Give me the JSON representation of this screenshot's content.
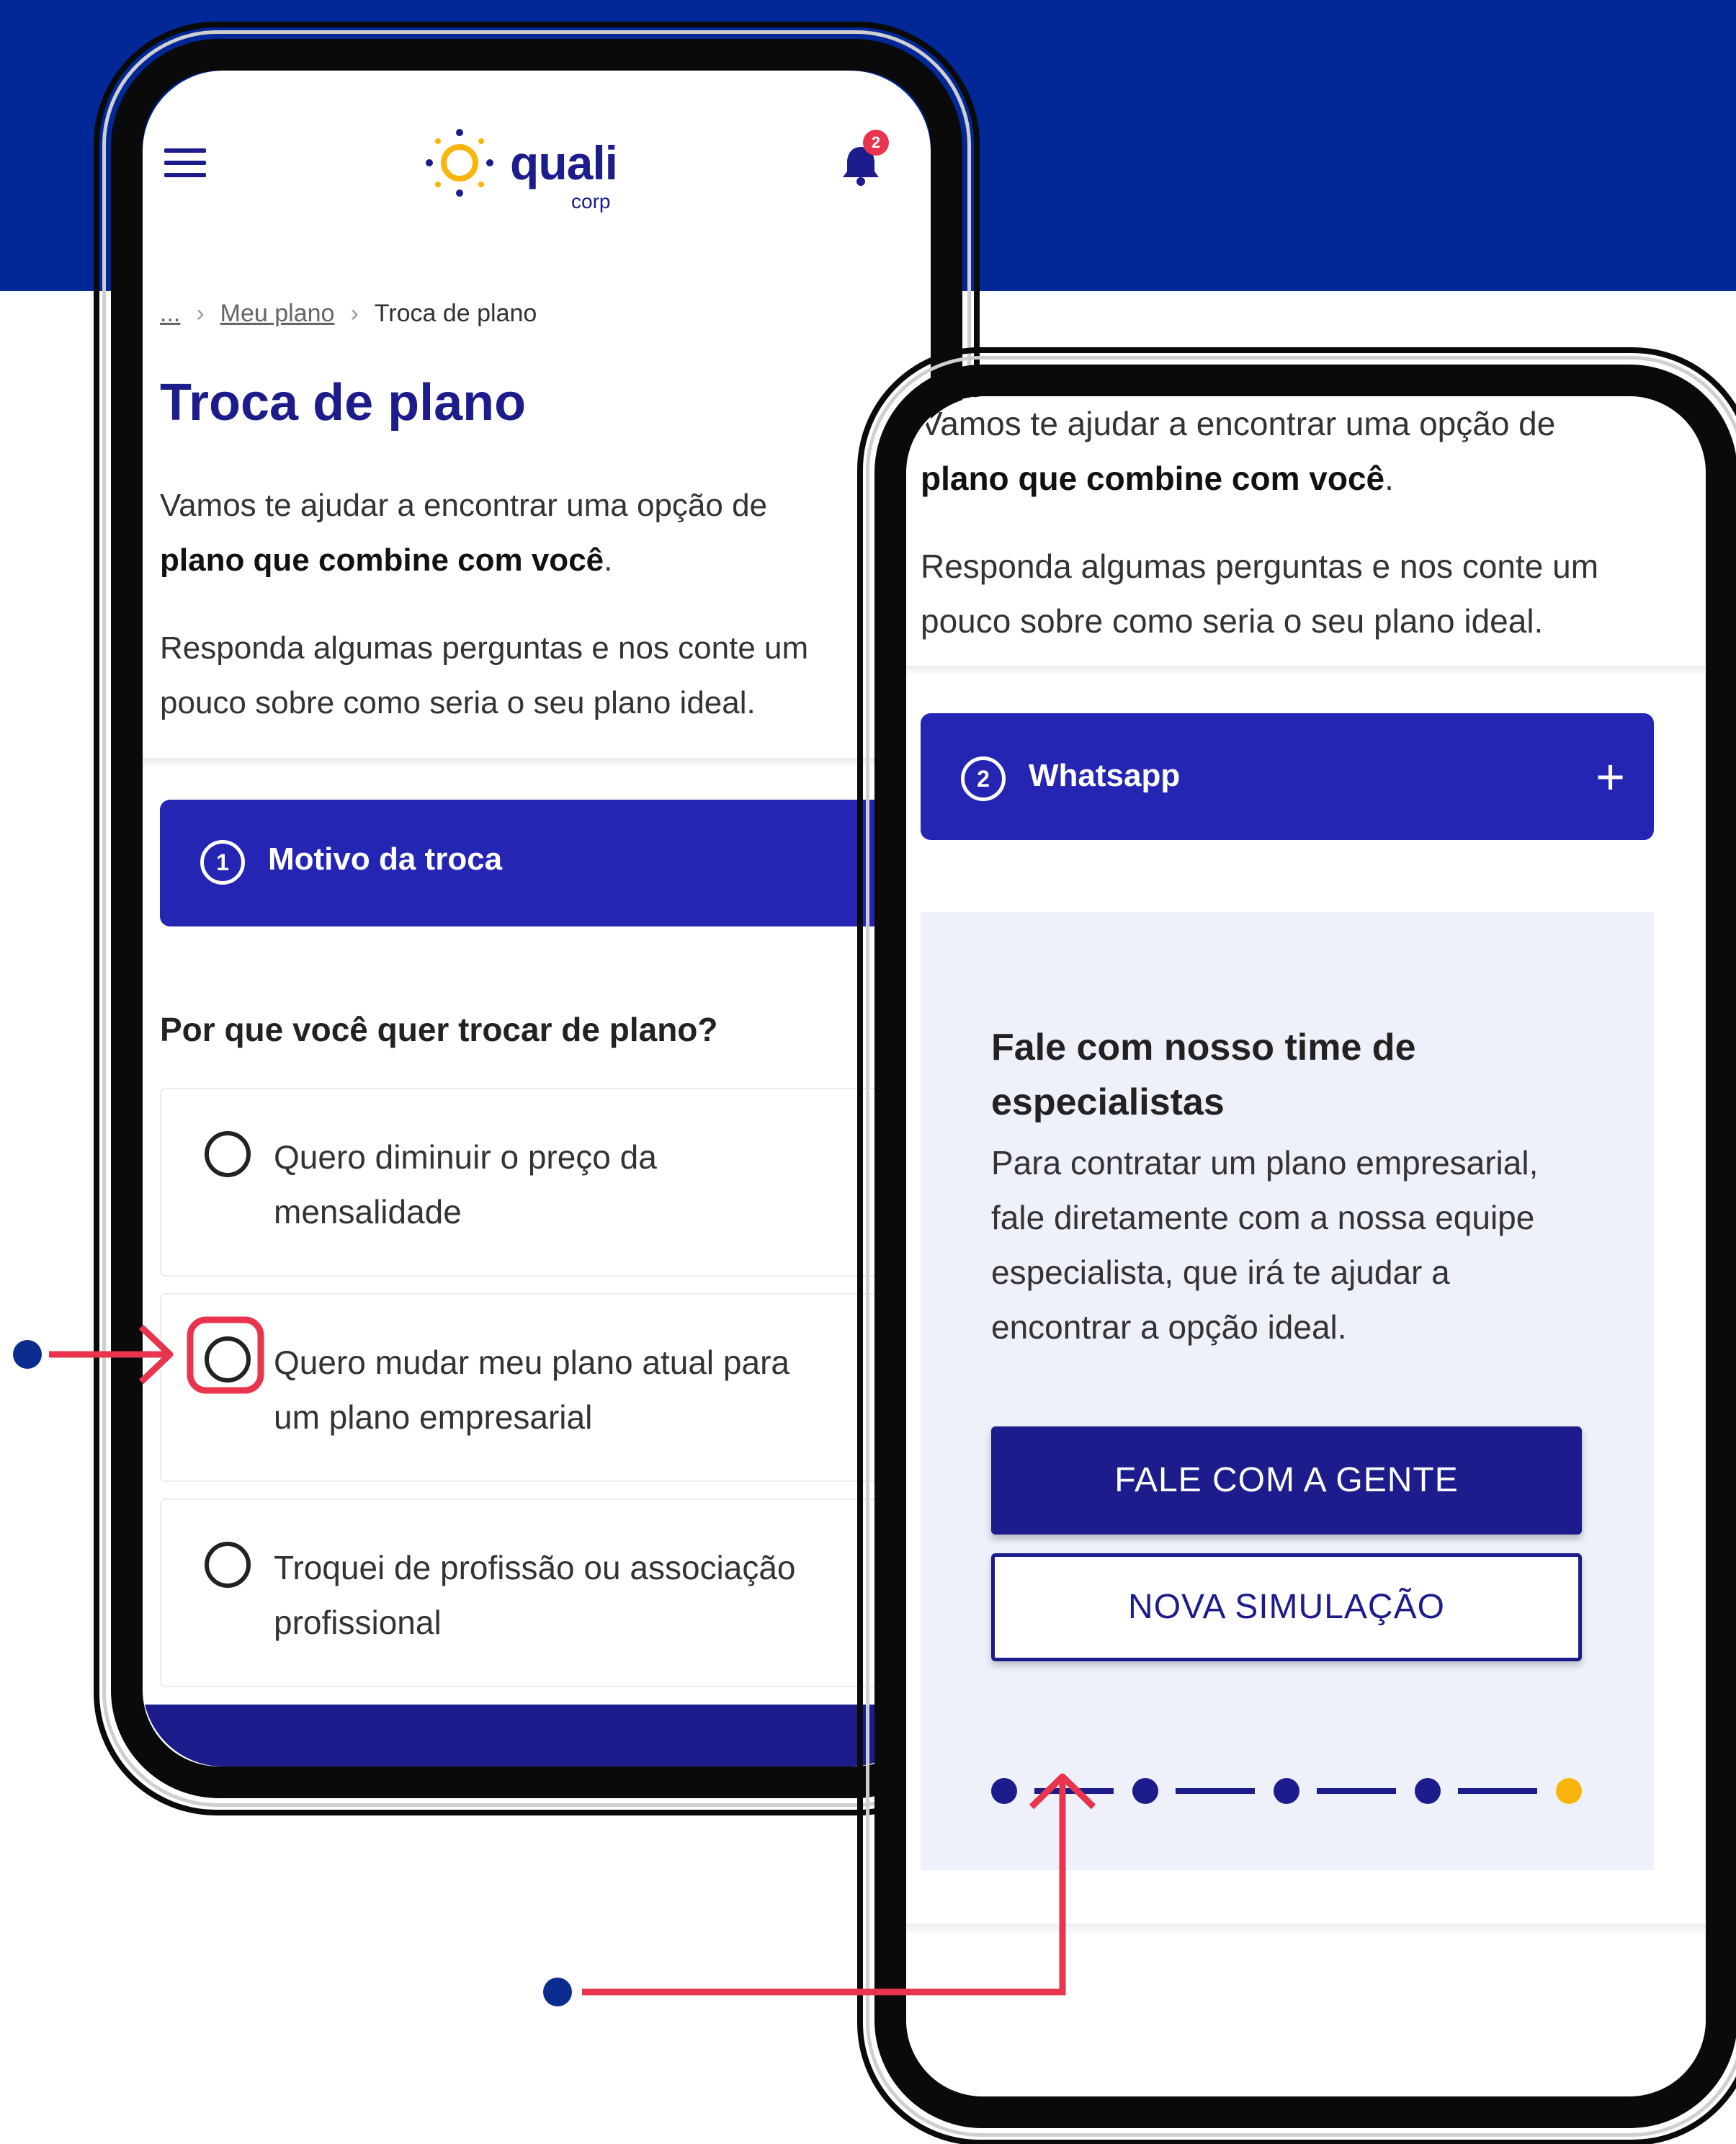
{
  "colors": {
    "hero_band": "#022897",
    "brand_navy": "#1c1c8c",
    "step_bar": "#2525b4",
    "annotation": "#e8344d",
    "annotation_dot": "#0b2c8f",
    "stepper_active": "#f9b50c",
    "card_bg": "#eef0fa"
  },
  "header": {
    "menu_icon": "hamburger-menu-icon",
    "logo_word": "quali",
    "logo_sub": "corp",
    "bell_icon": "bell-icon",
    "notification_count": "2"
  },
  "breadcrumb": {
    "root": "...",
    "items": [
      "Meu plano",
      "Troca de plano"
    ]
  },
  "left": {
    "title": "Troca de plano",
    "intro_line1": "Vamos te ajudar a encontrar uma opção de",
    "intro_line2_bold": "plano que combine com você",
    "intro_line2_end": ".",
    "intro2_line1": "Responda algumas perguntas e nos conte um",
    "intro2_line2": "pouco sobre como seria o seu plano ideal.",
    "step_number": "1",
    "step_label": "Motivo da troca",
    "question": "Por que você quer trocar de plano?",
    "options": [
      {
        "line1": "Quero diminuir o preço da",
        "line2": "mensalidade"
      },
      {
        "line1": "Quero mudar meu plano atual para",
        "line2": "um plano empresarial"
      },
      {
        "line1": "Troquei de profissão ou associação",
        "line2": "profissional"
      }
    ]
  },
  "right": {
    "intro_line1": "Vamos te ajudar a encontrar uma opção de",
    "intro_line2_bold": "plano que combine com você",
    "intro_line2_end": ".",
    "intro2_line1": "Responda algumas perguntas e nos conte um",
    "intro2_line2": "pouco sobre como seria o seu plano ideal.",
    "step_number": "2",
    "step_label": "Whatsapp",
    "expand_icon": "plus-icon",
    "card_title_line1": "Fale com nosso time de",
    "card_title_line2": "especialistas",
    "card_body": [
      "Para contratar um plano empresarial,",
      "fale diretamente com a nossa equipe",
      "especialista, que irá te ajudar a",
      "encontrar a opção ideal."
    ],
    "primary_button": "FALE COM A GENTE",
    "secondary_button": "NOVA SIMULAÇÃO",
    "stepper": {
      "total_steps": 5,
      "active_step": 5
    }
  }
}
